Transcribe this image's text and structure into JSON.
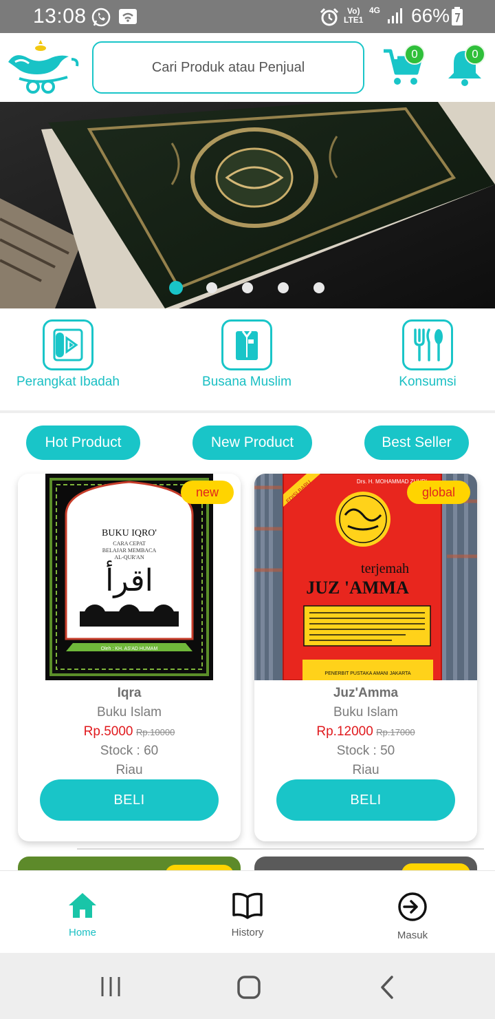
{
  "status_bar": {
    "time": "13:08",
    "battery": "66%",
    "network_volte": "Vo)) LTE1",
    "network_type": "4G"
  },
  "header": {
    "search_placeholder": "Cari Produk atau Penjual",
    "cart_count": "0",
    "notification_count": "0"
  },
  "banner": {
    "slide_count": 5,
    "active_slide": 1
  },
  "categories": [
    {
      "label": "Perangkat Ibadah",
      "icon": "prayer-mat-icon"
    },
    {
      "label": "Busana Muslim",
      "icon": "shirt-icon"
    },
    {
      "label": "Konsumsi",
      "icon": "utensils-icon"
    }
  ],
  "tabs": [
    {
      "label": "Hot Product"
    },
    {
      "label": "New Product"
    },
    {
      "label": "Best Seller"
    }
  ],
  "products": [
    {
      "tag": "new",
      "name": "Iqra",
      "category": "Buku Islam",
      "price": "Rp.5000",
      "old_price": "Rp.10000",
      "stock": "Stock : 60",
      "location": "Riau",
      "buy_label": "BELI",
      "cover": {
        "title": "BUKU IQRO'",
        "subtitle_1": "CARA CEPAT",
        "subtitle_2": "BELAJAR MEMBACA",
        "subtitle_3": "AL-QUR'AN",
        "arabic": "اقرأ",
        "author": "Oleh : KH. AS'AD HUMAM"
      }
    },
    {
      "tag": "global",
      "name": "Juz'Amma",
      "category": "Buku Islam",
      "price": "Rp.12000",
      "old_price": "Rp.17000",
      "stock": "Stock : 50",
      "location": "Riau",
      "buy_label": "BELI",
      "cover": {
        "author": "Drs. H. MOHAMMAD ZUHRI",
        "edition": "EDISI BARU",
        "title_small": "terjemah",
        "title_large": "JUZ 'AMMA",
        "publisher": "PENERBIT PUSTAKA AMANI JAKARTA"
      }
    }
  ],
  "bottom_nav": [
    {
      "label": "Home",
      "icon": "home-icon",
      "active": true
    },
    {
      "label": "History",
      "icon": "book-icon",
      "active": false
    },
    {
      "label": "Masuk",
      "icon": "login-icon",
      "active": false
    }
  ],
  "colors": {
    "accent": "#19c5c8",
    "price": "#e0191d",
    "tag_bg": "#ffd400",
    "badge": "#2fbf3a"
  }
}
